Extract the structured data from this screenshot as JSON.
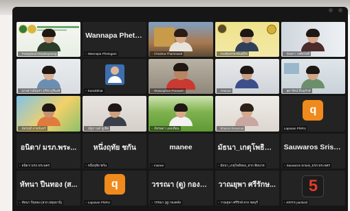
{
  "tiles": [
    {
      "caption": "Prawpimol Khaokoyoung"
    },
    {
      "big": "Wannapa Phetn...",
      "caption": "Wannapa Phetngam"
    },
    {
      "caption": "Chutima Thammasit"
    },
    {
      "caption": "กองคุ้มครองพันธุ์พืช"
    },
    {
      "caption": "รุ่งนภา วงศ์สวัสดิ์"
    },
    {
      "caption": "นางสาวอัจฉรา ปรีชาภูรีพงศ์"
    },
    {
      "caption": "Kanokkhat"
    },
    {
      "caption": "Wassaphon Poonarin"
    },
    {
      "caption": "Attanan"
    },
    {
      "caption": "สุดารัตน์ สินธุรักษ์"
    },
    {
      "caption": "ฉัตรฤดี สายจันทร์"
    },
    {
      "caption": "ณัฐกานต์ ชูเชิด"
    },
    {
      "caption": "ภัทรลดา แสงเดือน"
    },
    {
      "caption": "Sharon Rosemal"
    },
    {
      "caption": "Lapusan PhiRU"
    },
    {
      "big": "อนิดา/ มรภ.พระ...",
      "caption": "อนิดา/ มรภ.พระนคร"
    },
    {
      "big": "หนึ่งฤทัย ชกัน",
      "caption": "หนึ่งฤทัย ชกัน"
    },
    {
      "big": "manee",
      "caption": "manee"
    },
    {
      "big": "มัธนา_เกตุโพธิทอ...",
      "caption": "มัธนา_เกตุโพธิทอง_สวก.ชัยนาท"
    },
    {
      "big": "Sauwaros Srisu...",
      "caption": "Sauwaros Srisuk_มรภ.พระนคร"
    },
    {
      "big": "หัทนา ปีนทอง (ส...",
      "caption": "หัทนา ปีนทอง (สวก.ปทุมธานี)"
    },
    {
      "caption": "Lapusan PhiRU"
    },
    {
      "big": "วรรณา (ดู) กองคลัง",
      "caption": "วรรณา (ดู) กองคลัง"
    },
    {
      "big": "วาณยุพา ศรีรักษ...",
      "caption": "วาณยุพา ศรีรักษ์ สวก.ชลบุรี"
    },
    {
      "caption": "KRITS panlusit"
    }
  ]
}
